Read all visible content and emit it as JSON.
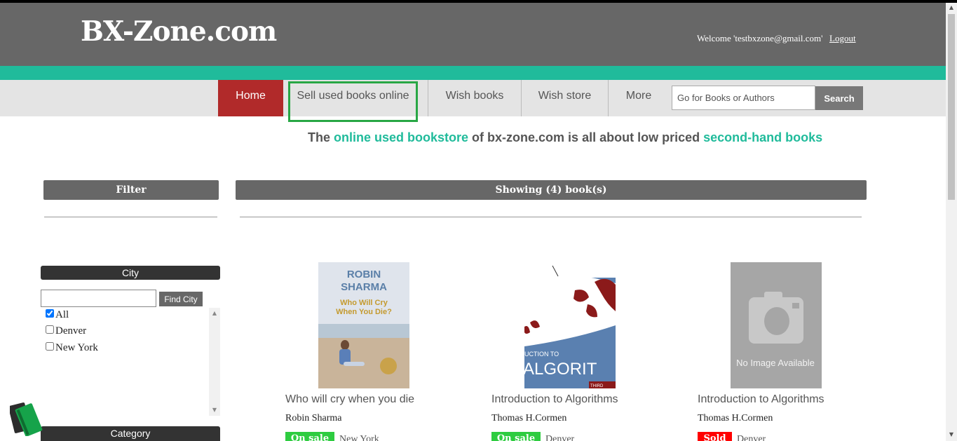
{
  "header": {
    "logo": "BX-Zone.com",
    "welcome": "Welcome 'testbxzone@gmail.com'",
    "logout": "Logout",
    "brand_color": "#676767",
    "accent_color": "#20bb9b"
  },
  "nav": {
    "items": [
      {
        "label": "Home",
        "active": true
      },
      {
        "label": "Sell used books online",
        "highlighted": true
      },
      {
        "label": "Wish books"
      },
      {
        "label": "Wish store"
      },
      {
        "label": "More"
      }
    ],
    "search_placeholder": "Go for Books or Authors",
    "search_button": "Search"
  },
  "tagline": {
    "part1": "The ",
    "link1": "online used bookstore",
    "part2": " of bx-zone.com is all about low priced ",
    "link2": "second-hand books"
  },
  "sidebar": {
    "filter_label": "Filter",
    "city_label": "City",
    "find_city_button": "Find City",
    "cities": [
      {
        "label": "All",
        "checked": true
      },
      {
        "label": "Denver",
        "checked": false
      },
      {
        "label": "New York",
        "checked": false
      }
    ],
    "category_label": "Category"
  },
  "results": {
    "showing_label": "Showing (4) book(s)",
    "books": [
      {
        "title": "Who will cry when you die",
        "author": "Robin Sharma",
        "status": "On sale",
        "status_color": "#2ecc40",
        "city": "New York",
        "cover_author": "ROBIN SHARMA",
        "cover_title": "Who Will Cry When You Die?"
      },
      {
        "title": "Introduction to Algorithms",
        "author": "Thomas H.Cormen",
        "status": "On sale",
        "status_color": "#2ecc40",
        "city": "Denver",
        "cover_text": "UCTION TO",
        "cover_big": "ALGORIT",
        "cover_small": "THIRD"
      },
      {
        "title": "Introduction to Algorithms",
        "author": "Thomas H.Cormen",
        "status": "Sold",
        "status_color": "#ff0000",
        "city": "Denver",
        "cover_text": "No Image Available"
      }
    ]
  }
}
